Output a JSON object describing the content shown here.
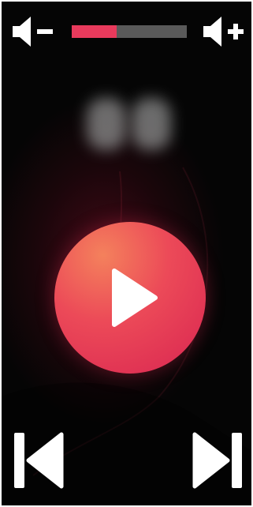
{
  "player": {
    "volume": {
      "level_percent": 39,
      "track_color": "#5a5a5a",
      "fill_color": "#e83a5c"
    },
    "icons": {
      "volume_down": "volume-down-icon",
      "volume_up": "volume-up-icon",
      "play": "play-icon",
      "previous": "skip-previous-icon",
      "next": "skip-next-icon"
    },
    "accent_colors": {
      "play_light": "#f4815c",
      "play_dark": "#d92551",
      "background": "#050505",
      "icon": "#ffffff"
    },
    "playback_state": "paused"
  }
}
